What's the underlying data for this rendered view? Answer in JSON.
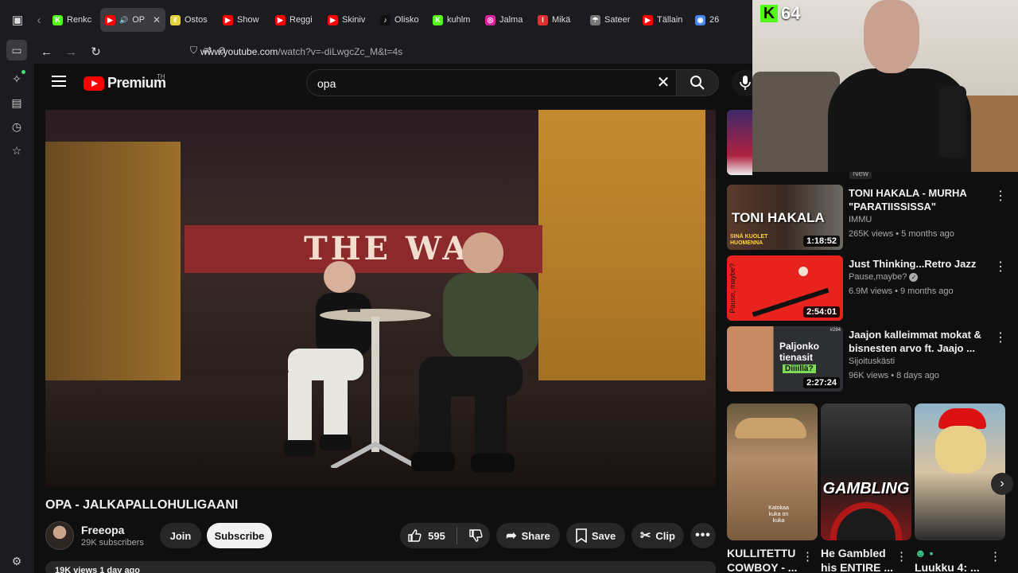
{
  "browser": {
    "tabs": [
      {
        "label": "Renkc",
        "fav_color": "#53fc18",
        "fav_glyph": "K"
      },
      {
        "label": "OP",
        "fav_color": "#ff0000",
        "fav_glyph": "▶",
        "active": true
      },
      {
        "label": "Ostos",
        "fav_color": "#e6d23a",
        "fav_glyph": "ℓ"
      },
      {
        "label": "Show",
        "fav_color": "#ff0000",
        "fav_glyph": "▶"
      },
      {
        "label": "Reggi",
        "fav_color": "#ff0000",
        "fav_glyph": "▶"
      },
      {
        "label": "Skiniv",
        "fav_color": "#ff0000",
        "fav_glyph": "▶"
      },
      {
        "label": "Olisko",
        "fav_color": "#111111",
        "fav_glyph": "♪"
      },
      {
        "label": "kuhlm",
        "fav_color": "#53fc18",
        "fav_glyph": "K"
      },
      {
        "label": "Jalma",
        "fav_color": "#d6249f",
        "fav_glyph": "◎"
      },
      {
        "label": "Mikä",
        "fav_color": "#e03131",
        "fav_glyph": "I"
      },
      {
        "label": "Sateer",
        "fav_color": "#777777",
        "fav_glyph": "☂"
      },
      {
        "label": "Tällain",
        "fav_color": "#ff0000",
        "fav_glyph": "▶"
      },
      {
        "label": "26",
        "fav_color": "#4285f4",
        "fav_glyph": "◉"
      }
    ],
    "url_host": "www.youtube.com",
    "url_rest": "/watch?v=-diLwgcZc_M&t=4s"
  },
  "youtube": {
    "logo_text": "Premium",
    "country": "TH",
    "search_value": "opa"
  },
  "video": {
    "title": "OPA - JALKAPALLOHULIGAANI",
    "banner_text": "THE WA",
    "channel": "Freeopa",
    "subscribers": "29K subscribers",
    "join_label": "Join",
    "subscribe_label": "Subscribe",
    "likes": "595",
    "share_label": "Share",
    "save_label": "Save",
    "clip_label": "Clip",
    "views_cut": "19K views  1 day ago"
  },
  "stream": {
    "kick_viewers": "64"
  },
  "new_label": "New",
  "recommendations": [
    {
      "title": "TONI HAKALA -  MURHA \"PARATIISSISSA\"",
      "channel": "IMMU",
      "meta": "265K views • 5 months ago",
      "duration": "1:18:52",
      "thumb_text": "TONI HAKALA",
      "thumb_sub": "SINÄ KUOLET HUOMENNA"
    },
    {
      "title": "Just Thinking...Retro Jazz",
      "channel": "Pause,maybe?",
      "meta": "6.9M views • 9 months ago",
      "duration": "2:54:01",
      "thumb_text": "Pause, maybe?",
      "verified": true
    },
    {
      "title": "Jaajon kalleimmat mokat & bisnesten arvo ft. Jaajo ...",
      "channel": "Sijoituskästi",
      "meta": "96K views • 8 days ago",
      "duration": "2:27:24",
      "thumb_text": "Paljonko tienasit",
      "thumb_sub": "Diiiillä?",
      "ep": "#284"
    }
  ],
  "shorts": [
    {
      "title": "KULLITETTU COWBOY - ...",
      "overlay": "Katokaa kuka on kuka"
    },
    {
      "title": "He Gambled his ENTIRE ...",
      "overlay": "GAMBLING"
    },
    {
      "title": "Luukku 4: ...",
      "overlay": ""
    }
  ]
}
